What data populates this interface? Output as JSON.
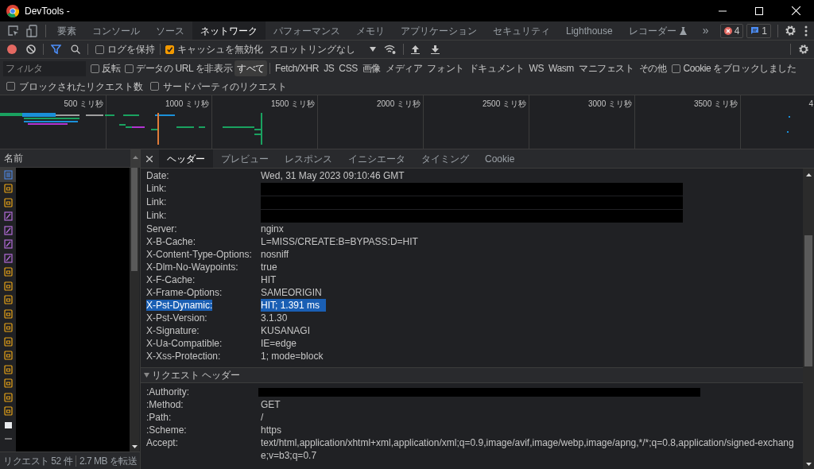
{
  "window": {
    "title": "DevTools -"
  },
  "main_tabs": [
    {
      "label": "要素",
      "selected": false
    },
    {
      "label": "コンソール",
      "selected": false
    },
    {
      "label": "ソース",
      "selected": false
    },
    {
      "label": "ネットワーク",
      "selected": true
    },
    {
      "label": "パフォーマンス",
      "selected": false
    },
    {
      "label": "メモリ",
      "selected": false
    },
    {
      "label": "アプリケーション",
      "selected": false
    },
    {
      "label": "セキュリティ",
      "selected": false
    },
    {
      "label": "Lighthouse",
      "selected": false
    },
    {
      "label": "レコーダー",
      "selected": false,
      "experimental": true
    }
  ],
  "more_tabs": "»",
  "badges": {
    "errors": "4",
    "messages": "1"
  },
  "toolbar": {
    "recording": true,
    "preserve_log": {
      "label": "ログを保持",
      "checked": false
    },
    "disable_cache": {
      "label": "キャッシュを無効化",
      "checked": true
    },
    "throttling": "スロットリングなし"
  },
  "filter": {
    "placeholder": "フィルタ",
    "invert": {
      "label": "反転",
      "checked": false
    },
    "hide_data_urls": {
      "label": "データの URL を非表示",
      "checked": false
    },
    "types": [
      {
        "label": "すべて",
        "selected": true
      },
      {
        "label": "Fetch/XHR",
        "selected": false
      },
      {
        "label": "JS",
        "selected": false
      },
      {
        "label": "CSS",
        "selected": false
      },
      {
        "label": "画像",
        "selected": false
      },
      {
        "label": "メディア",
        "selected": false
      },
      {
        "label": "フォント",
        "selected": false
      },
      {
        "label": "ドキュメント",
        "selected": false
      },
      {
        "label": "WS",
        "selected": false
      },
      {
        "label": "Wasm",
        "selected": false
      },
      {
        "label": "マニフェスト",
        "selected": false
      },
      {
        "label": "その他",
        "selected": false
      }
    ],
    "blocked_cookies": {
      "label": "Cookie をブロックしました",
      "checked": false
    },
    "blocked_requests": {
      "label": "ブロックされたリクエスト数",
      "checked": false
    },
    "third_party": {
      "label": "サードパーティのリクエスト",
      "checked": false
    }
  },
  "overview": {
    "ticks": [
      "500 ミリ秒",
      "1000 ミリ秒",
      "1500 ミリ秒",
      "2000 ミリ秒",
      "2500 ミリ秒",
      "3000 ミリ秒",
      "3500 ミリ秒",
      "4"
    ]
  },
  "requests": {
    "column": "名前",
    "items": [
      {
        "kind": "document",
        "selected": true
      },
      {
        "kind": "script",
        "selected": false
      },
      {
        "kind": "script",
        "selected": false
      },
      {
        "kind": "stylesheet",
        "selected": false
      },
      {
        "kind": "stylesheet",
        "selected": false
      },
      {
        "kind": "stylesheet",
        "selected": false
      },
      {
        "kind": "stylesheet",
        "selected": false
      },
      {
        "kind": "script",
        "selected": false
      },
      {
        "kind": "script",
        "selected": false
      },
      {
        "kind": "script",
        "selected": false
      },
      {
        "kind": "script",
        "selected": false
      },
      {
        "kind": "script",
        "selected": false
      },
      {
        "kind": "script",
        "selected": false
      },
      {
        "kind": "script",
        "selected": false
      },
      {
        "kind": "script",
        "selected": false
      },
      {
        "kind": "script",
        "selected": false
      },
      {
        "kind": "script",
        "selected": false
      },
      {
        "kind": "script",
        "selected": false
      },
      {
        "kind": "image",
        "selected": false
      },
      {
        "kind": "other",
        "selected": false
      }
    ]
  },
  "detail_tabs": [
    {
      "label": "ヘッダー",
      "selected": true
    },
    {
      "label": "プレビュー",
      "selected": false
    },
    {
      "label": "レスポンス",
      "selected": false
    },
    {
      "label": "イニシエータ",
      "selected": false
    },
    {
      "label": "タイミング",
      "selected": false
    },
    {
      "label": "Cookie",
      "selected": false
    }
  ],
  "response_headers": [
    {
      "name": "Date:",
      "value": "Wed, 31 May 2023 09:10:46 GMT",
      "selected": false
    },
    {
      "name": "Link:",
      "redacted": true,
      "selected": false
    },
    {
      "name": "Link:",
      "redacted": true,
      "selected": false
    },
    {
      "name": "Link:",
      "redacted": true,
      "selected": false
    },
    {
      "name": "Server:",
      "value": "nginx",
      "selected": false
    },
    {
      "name": "X-B-Cache:",
      "value": "L=MISS/CREATE:B=BYPASS:D=HIT",
      "selected": false
    },
    {
      "name": "X-Content-Type-Options:",
      "value": "nosniff",
      "selected": false
    },
    {
      "name": "X-Dlm-No-Waypoints:",
      "value": "true",
      "selected": false
    },
    {
      "name": "X-F-Cache:",
      "value": "HIT",
      "selected": false
    },
    {
      "name": "X-Frame-Options:",
      "value": "SAMEORIGIN",
      "selected": false
    },
    {
      "name": "X-Pst-Dynamic:",
      "value": "HIT; 1.391 ms",
      "selected": true
    },
    {
      "name": "X-Pst-Version:",
      "value": "3.1.30",
      "selected": false
    },
    {
      "name": "X-Signature:",
      "value": "KUSANAGI",
      "selected": false
    },
    {
      "name": "X-Ua-Compatible:",
      "value": "IE=edge",
      "selected": false
    },
    {
      "name": "X-Xss-Protection:",
      "value": "1; mode=block",
      "selected": false
    }
  ],
  "request_headers": {
    "title": "リクエスト ヘッダー",
    "expanded": true,
    "rows": [
      {
        "name": ":Authority:",
        "redacted": true,
        "selected": false
      },
      {
        "name": ":Method:",
        "value": "GET",
        "selected": false
      },
      {
        "name": ":Path:",
        "value": "/",
        "selected": false
      },
      {
        "name": ":Scheme:",
        "value": "https",
        "selected": false
      },
      {
        "name": "Accept:",
        "value": "text/html,application/xhtml+xml,application/xml;q=0.9,image/avif,image/webp,image/apng,*/*;q=0.8,application/signed-exchange;v=b3;q=0.7",
        "selected": false
      }
    ]
  },
  "status_bar": {
    "requests": "リクエスト 52 件",
    "transferred": "2.7 MB を転送"
  }
}
